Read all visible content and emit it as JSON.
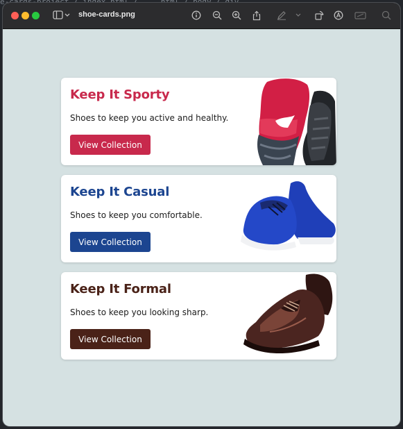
{
  "window": {
    "title": "shoe-cards.png",
    "background_behind": "e-cards-project / index.html / ... html / body / div"
  },
  "cards": [
    {
      "title": "Keep It Sporty",
      "description": "Shoes to keep you active and healthy.",
      "button_label": "View Collection",
      "accent_color": "#c8294c",
      "image": "red-sport-sneaker"
    },
    {
      "title": "Keep It Casual",
      "description": "Shoes to keep you comfortable.",
      "button_label": "View Collection",
      "accent_color": "#1c4590",
      "image": "blue-casual-sneaker"
    },
    {
      "title": "Keep It Formal",
      "description": "Shoes to keep you looking sharp.",
      "button_label": "View Collection",
      "accent_color": "#4a2218",
      "image": "brown-formal-shoe"
    }
  ],
  "colors": {
    "page_background": "#d5e1e2",
    "card_background": "#ffffff",
    "titlebar": "#2c2c2e"
  }
}
